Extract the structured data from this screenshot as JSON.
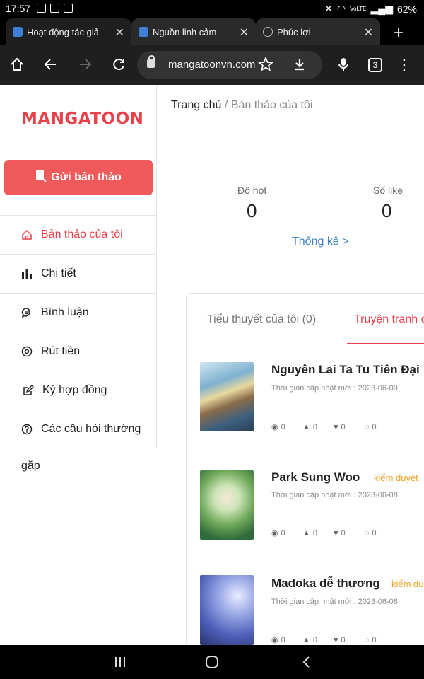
{
  "status_bar": {
    "time": "17:57",
    "battery": "62%",
    "network": "VoLTE"
  },
  "tabs": [
    {
      "title": "Hoạt động tác giả",
      "favicon": "mangatoon-icon"
    },
    {
      "title": "Nguồn linh cảm",
      "favicon": "mangatoon-icon"
    },
    {
      "title": "Phúc lợi",
      "favicon": "globe-icon"
    }
  ],
  "toolbar": {
    "url": "mangatoonvn.com",
    "tab_count": "3"
  },
  "sidebar": {
    "logo": "MANGATOON",
    "submit_label": "Gửi bản thảo",
    "items": [
      {
        "label": "Bản thảo của tôi",
        "icon": "home-icon"
      },
      {
        "label": "Chi tiết",
        "icon": "bar-chart-icon"
      },
      {
        "label": "Bình luận",
        "icon": "comment-icon"
      },
      {
        "label": "Rút tiền",
        "icon": "coin-icon"
      },
      {
        "label": "Ký hợp đồng",
        "icon": "edit-icon"
      },
      {
        "label": "Các câu hỏi thường",
        "icon": "help-icon"
      }
    ],
    "overflow": "gặp"
  },
  "breadcrumb": {
    "home": "Trang chủ",
    "separator": "/",
    "current": "Bản thảo của tôi"
  },
  "stats": {
    "hot_label": "Độ hot",
    "hot_value": "0",
    "like_label": "Số like",
    "like_value": "0",
    "link": "Thống kê >"
  },
  "content_tabs": {
    "novels": "Tiểu thuyết của tôi (0)",
    "comics": "Truyện tranh c"
  },
  "works": [
    {
      "title": "Nguyên Lai Ta Tu Tiên Đại",
      "badge": "",
      "updated": "Thời gian cập nhật mới : 2023-06-09",
      "views": "0",
      "likes": "0",
      "hearts": "0",
      "comments": "0"
    },
    {
      "title": "Park Sung Woo",
      "badge": "kiểm duyệt",
      "updated": "Thời gian cập nhật mới : 2023-06-08",
      "views": "0",
      "likes": "0",
      "hearts": "0",
      "comments": "0"
    },
    {
      "title": "Madoka dễ thương",
      "badge": "kiểm du",
      "updated": "Thời gian cập nhật mới : 2023-06-08",
      "views": "0",
      "likes": "0",
      "hearts": "0",
      "comments": "0"
    }
  ],
  "colors": {
    "accent": "#e8414a",
    "button": "#f05a5a",
    "link": "#3d7fc2",
    "badge": "#f0a020"
  }
}
